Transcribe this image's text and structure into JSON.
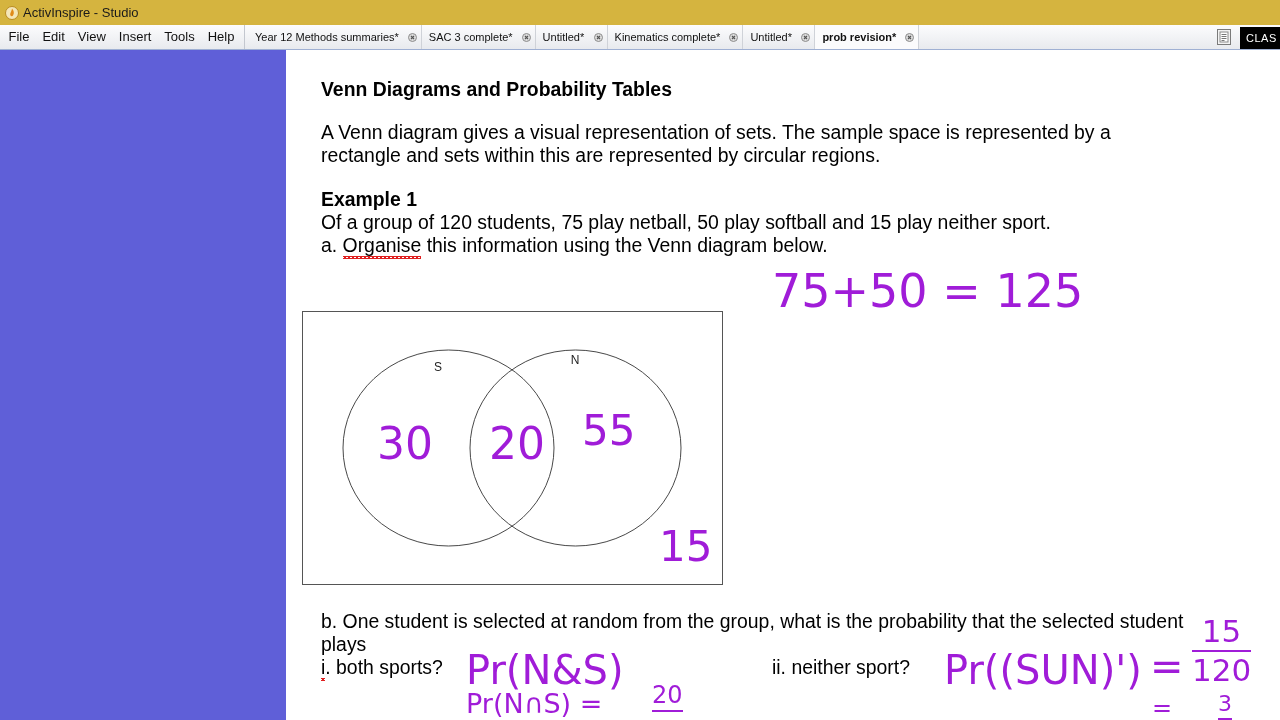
{
  "window": {
    "title": "ActivInspire - Studio"
  },
  "menu": [
    "File",
    "Edit",
    "View",
    "Insert",
    "Tools",
    "Help"
  ],
  "tabs": [
    {
      "label": "Year 12 Methods summaries*",
      "selected": false
    },
    {
      "label": "SAC 3 complete*",
      "selected": false
    },
    {
      "label": "Untitled*",
      "selected": false
    },
    {
      "label": "Kinematics complete*",
      "selected": false
    },
    {
      "label": "Untitled*",
      "selected": false
    },
    {
      "label": "prob revision*",
      "selected": true
    }
  ],
  "toolbar": {
    "button": "CLAS"
  },
  "page": {
    "heading": "Venn Diagrams and Probability Tables",
    "intro": "A Venn diagram gives a visual representation of sets. The sample space is represented by a rectangle and sets within this are represented by circular regions.",
    "example": {
      "title": "Example 1",
      "text": "Of a group of 120 students, 75 play netball, 50 play softball and 15 play neither sport.",
      "part_a": [
        {
          "text": "a. ",
          "misspelled": false
        },
        {
          "text": "Organise",
          "misspelled": true
        },
        {
          "text": " this information using the Venn diagram below.",
          "misspelled": false
        }
      ]
    },
    "venn": {
      "sets": [
        {
          "label": "S"
        },
        {
          "label": "N"
        }
      ]
    },
    "part_b": {
      "text": "b. One student is selected at random from the group, what is the probability that the selected student plays",
      "questions": [
        {
          "parts": [
            {
              "text": "i",
              "misspelled": true
            },
            {
              "text": ". both sports?",
              "misspelled": false
            }
          ]
        },
        {
          "parts": [
            {
              "text": "ii. neither sport?",
              "misspelled": false
            }
          ]
        }
      ]
    }
  },
  "ink": [
    {
      "kind": "text",
      "text": "75+50 = 125"
    },
    {
      "kind": "text",
      "text": "30"
    },
    {
      "kind": "text",
      "text": "20"
    },
    {
      "kind": "text",
      "text": "55"
    },
    {
      "kind": "text",
      "text": "15"
    },
    {
      "kind": "text",
      "text": "Pr(N&S)"
    },
    {
      "kind": "text",
      "text": "Pr((SUN)')"
    },
    {
      "kind": "text",
      "text": "="
    },
    {
      "kind": "fraction",
      "numerator": "15",
      "denominator": "120"
    },
    {
      "kind": "text",
      "text": "Pr(N∩S) ="
    },
    {
      "kind": "fraction",
      "numerator": "20"
    },
    {
      "kind": "text",
      "text": "="
    },
    {
      "kind": "fraction",
      "numerator": "3"
    }
  ]
}
